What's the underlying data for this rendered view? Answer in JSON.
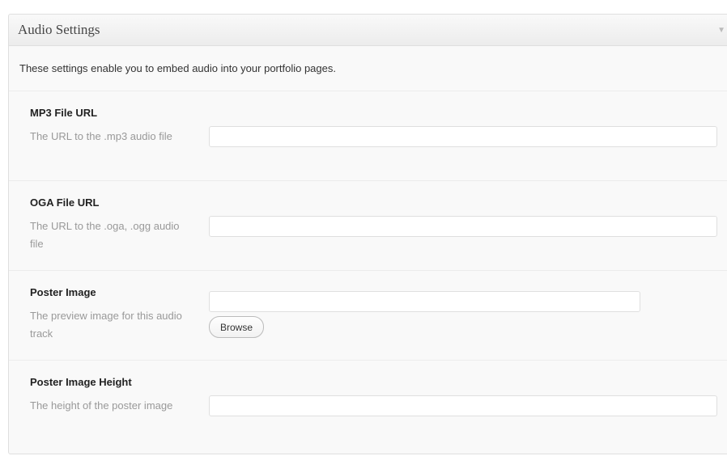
{
  "panel": {
    "title": "Audio Settings",
    "toggle_icon": "▼",
    "intro": "These settings enable you to embed audio into your portfolio pages."
  },
  "fields": [
    {
      "label": "MP3 File URL",
      "description": "The URL to the .mp3 audio file",
      "value": "",
      "placeholder": ""
    },
    {
      "label": "OGA File URL",
      "description": "The URL to the .oga, .ogg audio file",
      "value": "",
      "placeholder": ""
    },
    {
      "label": "Poster Image",
      "description": "The preview image for this audio track",
      "value": "",
      "placeholder": "",
      "button_label": "Browse"
    },
    {
      "label": "Poster Image Height",
      "description": "The height of the poster image",
      "value": "",
      "placeholder": ""
    }
  ]
}
